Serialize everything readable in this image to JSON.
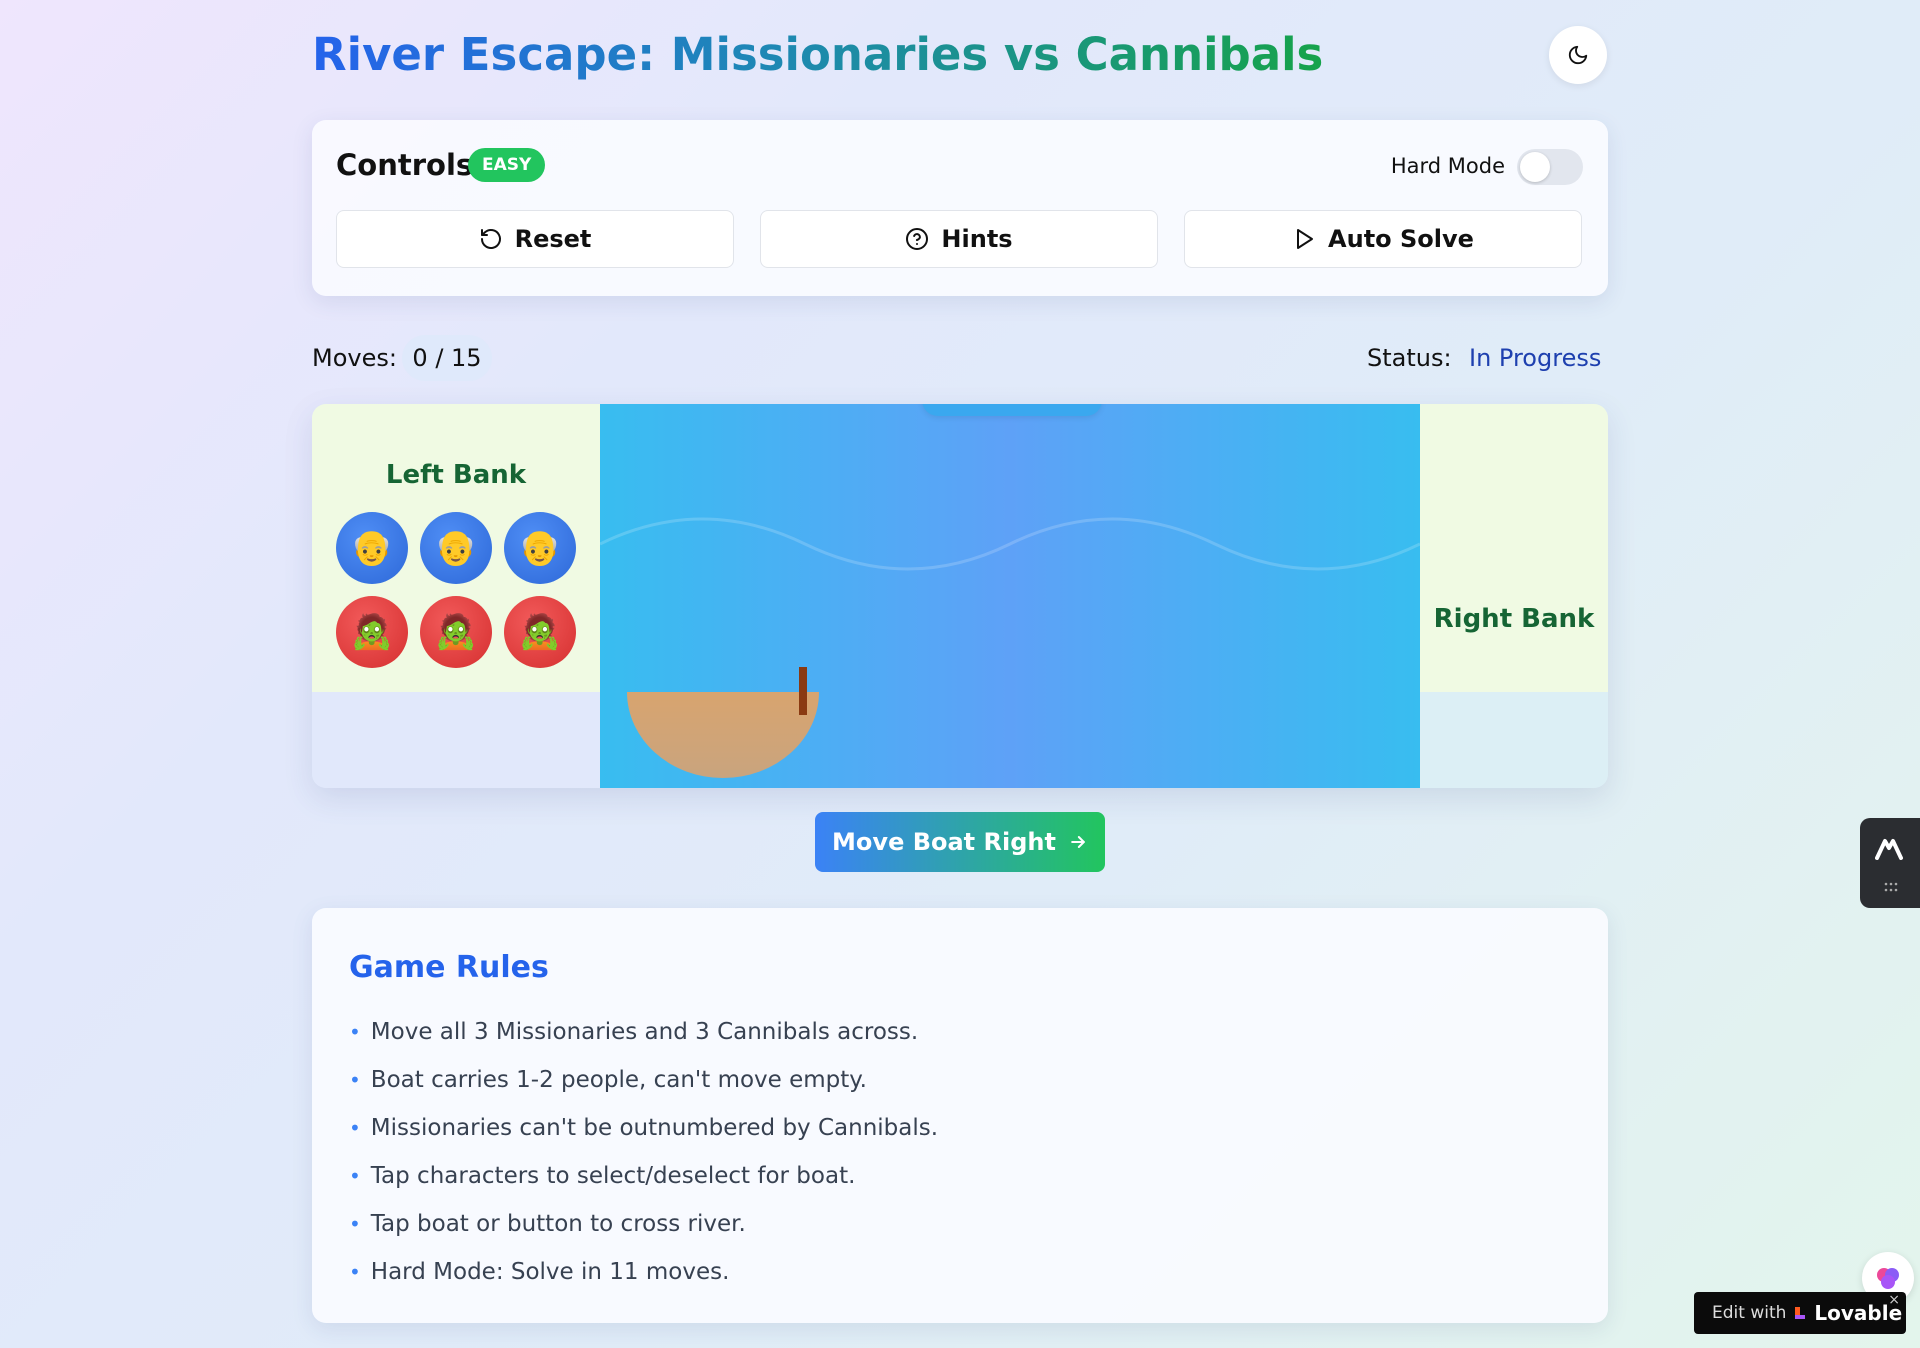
{
  "header": {
    "title": "River Escape: Missionaries vs Cannibals",
    "theme_icon": "moon-icon"
  },
  "controls": {
    "title": "Controls",
    "difficulty_badge": "EASY",
    "hard_mode_label": "Hard Mode",
    "hard_mode_on": false,
    "buttons": [
      {
        "label": "Reset",
        "icon": "rotate-ccw-icon"
      },
      {
        "label": "Hints",
        "icon": "help-circle-icon"
      },
      {
        "label": "Auto Solve",
        "icon": "play-icon"
      }
    ]
  },
  "stats": {
    "moves_label": "Moves:",
    "moves_value": "0 / 15",
    "status_label": "Status:",
    "status_value": "In Progress"
  },
  "scene": {
    "left_bank": {
      "label": "Left Bank",
      "missionaries": [
        "👴",
        "👴",
        "👴"
      ],
      "cannibals": [
        "🧟",
        "🧟",
        "🧟"
      ]
    },
    "right_bank": {
      "label": "Right Bank"
    },
    "boat_side": "left"
  },
  "move_button": {
    "label": "Move Boat Right",
    "icon": "arrow-right-icon"
  },
  "rules": {
    "title": "Game Rules",
    "items": [
      "Move all 3 Missionaries and 3 Cannibals across.",
      "Boat carries 1-2 people, can't move empty.",
      "Missionaries can't be outnumbered by Cannibals.",
      "Tap characters to select/deselect for boat.",
      "Tap boat or button to cross river.",
      "Hard Mode: Solve in 11 moves."
    ]
  },
  "badge": {
    "prefix": "Edit with",
    "brand": "Lovable",
    "close": "×"
  },
  "colors": {
    "primary": "#2563eb",
    "accent": "#22c55e",
    "missionary": "#2d68d8",
    "cannibal": "#d52f2f",
    "river": "#5ea1f7"
  }
}
